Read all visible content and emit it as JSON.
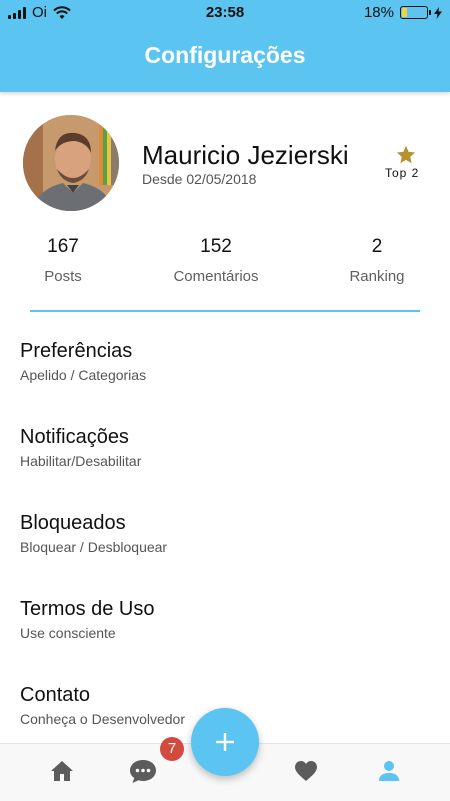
{
  "status_bar": {
    "carrier": "Oi",
    "time": "23:58",
    "battery_percent": "18%",
    "battery_level": 0.18
  },
  "header": {
    "title": "Configurações"
  },
  "profile": {
    "name": "Mauricio Jezierski",
    "since": "Desde 02/05/2018",
    "rank_label": "Top 2",
    "stats": [
      {
        "value": "167",
        "label": "Posts"
      },
      {
        "value": "152",
        "label": "Comentários"
      },
      {
        "value": "2",
        "label": "Ranking"
      }
    ]
  },
  "menu": [
    {
      "title": "Preferências",
      "subtitle": "Apelido / Categorias"
    },
    {
      "title": "Notificações",
      "subtitle": "Habilitar/Desabilitar"
    },
    {
      "title": "Bloqueados",
      "subtitle": "Bloquear / Desbloquear"
    },
    {
      "title": "Termos de Uso",
      "subtitle": "Use consciente"
    },
    {
      "title": "Contato",
      "subtitle": "Conheça o Desenvolvedor"
    }
  ],
  "bottom_nav": {
    "messages_badge": "7",
    "icons": [
      "home-icon",
      "chat-icon",
      "plus-icon",
      "heart-icon",
      "person-icon"
    ]
  },
  "colors": {
    "accent": "#5bc4f1",
    "badge": "#d24b3e",
    "star": "#b8912e",
    "icon_gray": "#5c5c5c"
  }
}
